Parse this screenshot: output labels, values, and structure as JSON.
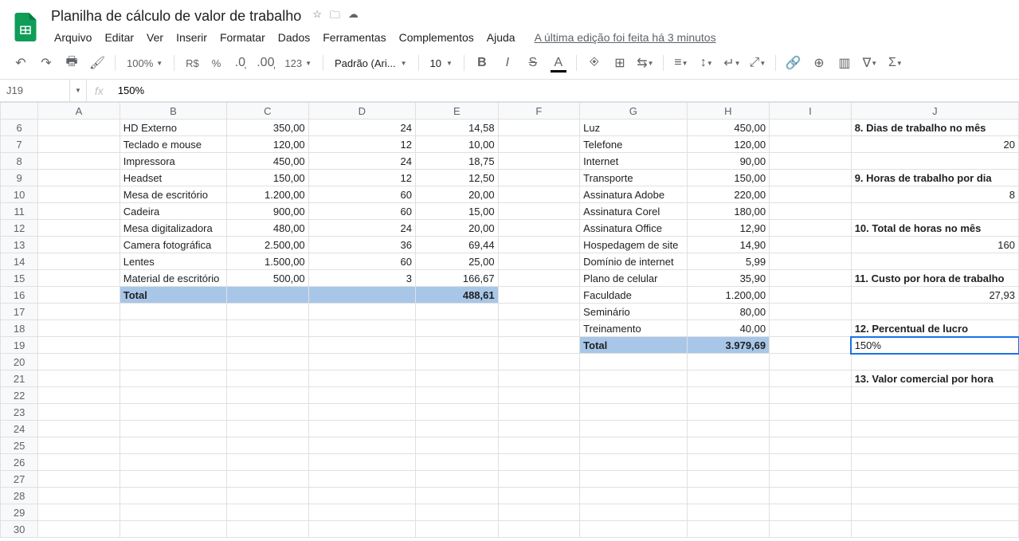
{
  "doc": {
    "title": "Planilha de cálculo de valor de trabalho"
  },
  "menu": {
    "arquivo": "Arquivo",
    "editar": "Editar",
    "ver": "Ver",
    "inserir": "Inserir",
    "formatar": "Formatar",
    "dados": "Dados",
    "ferramentas": "Ferramentas",
    "complementos": "Complementos",
    "ajuda": "Ajuda",
    "editinfo": "A última edição foi feita há 3 minutos"
  },
  "toolbar": {
    "zoom": "100%",
    "currency": "R$",
    "pct": "%",
    "fmt123": "123",
    "font": "Padrão (Ari...",
    "size": "10"
  },
  "namebox": "J19",
  "formula": "150%",
  "cols": [
    "A",
    "B",
    "C",
    "D",
    "E",
    "F",
    "G",
    "H",
    "I",
    "J"
  ],
  "startRow": 6,
  "endRow": 30,
  "cells": {
    "B6": "HD Externo",
    "C6": "350,00",
    "D6": "24",
    "E6": "14,58",
    "G6": "Luz",
    "H6": "450,00",
    "J6": "8. Dias de trabalho no mês",
    "B7": "Teclado e mouse",
    "C7": "120,00",
    "D7": "12",
    "E7": "10,00",
    "G7": "Telefone",
    "H7": "120,00",
    "J7": "20",
    "B8": "Impressora",
    "C8": "450,00",
    "D8": "24",
    "E8": "18,75",
    "G8": "Internet",
    "H8": "90,00",
    "B9": "Headset",
    "C9": "150,00",
    "D9": "12",
    "E9": "12,50",
    "G9": "Transporte",
    "H9": "150,00",
    "J9": "9. Horas de trabalho por dia",
    "B10": "Mesa de escritório",
    "C10": "1.200,00",
    "D10": "60",
    "E10": "20,00",
    "G10": "Assinatura Adobe",
    "H10": "220,00",
    "J10": "8",
    "B11": "Cadeira",
    "C11": "900,00",
    "D11": "60",
    "E11": "15,00",
    "G11": "Assinatura Corel",
    "H11": "180,00",
    "B12": "Mesa digitalizadora",
    "C12": "480,00",
    "D12": "24",
    "E12": "20,00",
    "G12": "Assinatura Office",
    "H12": "12,90",
    "J12": "10. Total de horas no mês",
    "B13": "Camera fotográfica",
    "C13": "2.500,00",
    "D13": "36",
    "E13": "69,44",
    "G13": "Hospedagem de site",
    "H13": "14,90",
    "J13": "160",
    "B14": "Lentes",
    "C14": "1.500,00",
    "D14": "60",
    "E14": "25,00",
    "G14": "Domínio de internet",
    "H14": "5,99",
    "B15": "Material de escritório",
    "C15": "500,00",
    "D15": "3",
    "E15": "166,67",
    "G15": "Plano de celular",
    "H15": "35,90",
    "J15": "11. Custo por hora de trabalho",
    "B16": "Total",
    "E16": "488,61",
    "G16": "Faculdade",
    "H16": "1.200,00",
    "J16": "27,93",
    "G17": "Seminário",
    "H17": "80,00",
    "G18": "Treinamento",
    "H18": "40,00",
    "J18": "12. Percentual de lucro",
    "G19": "Total",
    "H19": "3.979,69",
    "J19": "150%",
    "J21": "13. Valor comercial por hora"
  },
  "numericCols": [
    "C",
    "D",
    "E",
    "H"
  ],
  "numericCells": [
    "J7",
    "J10",
    "J13",
    "J16"
  ],
  "boldCells": [
    "J6",
    "J9",
    "J12",
    "J15",
    "J18",
    "J21",
    "B16",
    "E16",
    "G19",
    "H19"
  ],
  "highlightCells": [
    "B16",
    "C16",
    "D16",
    "E16",
    "G19",
    "H19"
  ],
  "selectedCell": "J19"
}
